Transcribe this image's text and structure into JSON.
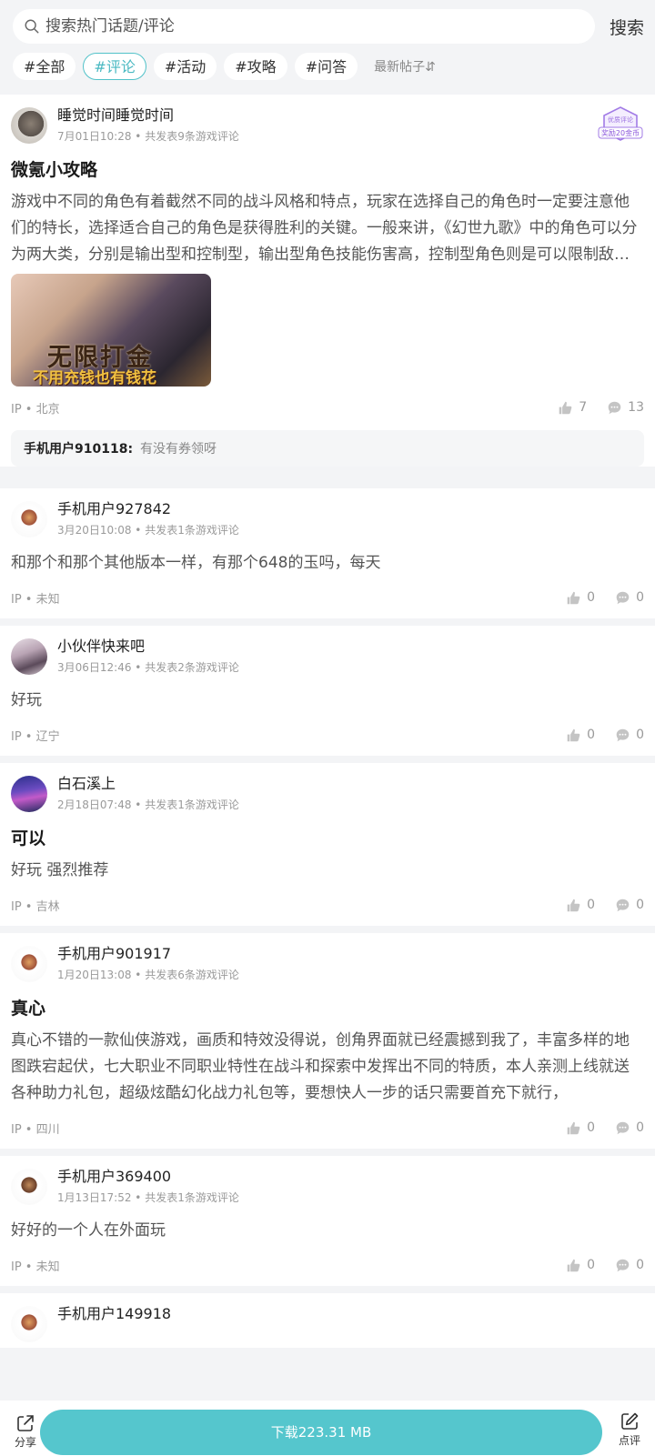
{
  "search": {
    "placeholder": "搜索热门话题/评论",
    "button": "搜索"
  },
  "tags": [
    "#全部",
    "#评论",
    "#活动",
    "#攻略",
    "#问答"
  ],
  "sort_label": "最新帖子⇵",
  "posts": [
    {
      "user": "睡觉时间睡觉时间",
      "meta": "7月01日10:28 • 共发表9条游戏评论",
      "title": "微氪小攻略",
      "body": "游戏中不同的角色有着截然不同的战斗风格和特点，玩家在选择自己的角色时一定要注意他们的特长，选择适合自己的角色是获得胜利的关键。一般来讲，《幻世九歌》中的角色可以分为两大类，分别是输出型和控制型，输出型角色技能伤害高，控制型角色则是可以限制敌人行动。",
      "image_text_1": "无限打金",
      "image_text_2": "不用充钱也有钱花",
      "badge_line1": "优质评论",
      "badge_line2": "奖励20金币",
      "ip": "IP • 北京",
      "likes": "7",
      "comments": "13",
      "reply_user": "手机用户910118:",
      "reply_text": "有没有券领呀"
    },
    {
      "user": "手机用户927842",
      "meta": "3月20日10:08 • 共发表1条游戏评论",
      "body": "和那个和那个其他版本一样，有那个648的玉吗，每天",
      "ip": "IP • 未知",
      "likes": "0",
      "comments": "0"
    },
    {
      "user": "小伙伴快来吧",
      "meta": "3月06日12:46 • 共发表2条游戏评论",
      "body": "好玩",
      "ip": "IP • 辽宁",
      "likes": "0",
      "comments": "0"
    },
    {
      "user": "白石溪上",
      "meta": "2月18日07:48 • 共发表1条游戏评论",
      "title": "可以",
      "body": "好玩 强烈推荐",
      "ip": "IP • 吉林",
      "likes": "0",
      "comments": "0"
    },
    {
      "user": "手机用户901917",
      "meta": "1月20日13:08 • 共发表6条游戏评论",
      "title": "真心",
      "body": "真心不错的一款仙侠游戏，画质和特效没得说，创角界面就已经震撼到我了，丰富多样的地图跌宕起伏，七大职业不同职业特性在战斗和探索中发挥出不同的特质，本人亲测上线就送各种助力礼包，超级炫酷幻化战力礼包等，要想快人一步的话只需要首充下就行，",
      "ip": "IP • 四川",
      "likes": "0",
      "comments": "0"
    },
    {
      "user": "手机用户369400",
      "meta": "1月13日17:52 • 共发表1条游戏评论",
      "body": "好好的一个人在外面玩",
      "ip": "IP • 未知",
      "likes": "0",
      "comments": "0"
    },
    {
      "user": "手机用户149918"
    }
  ],
  "bottom": {
    "share": "分享",
    "download": "下载223.31 MB",
    "review": "点评"
  },
  "colors": {
    "accent": "#55c6cd",
    "background": "#f3f4f6"
  }
}
